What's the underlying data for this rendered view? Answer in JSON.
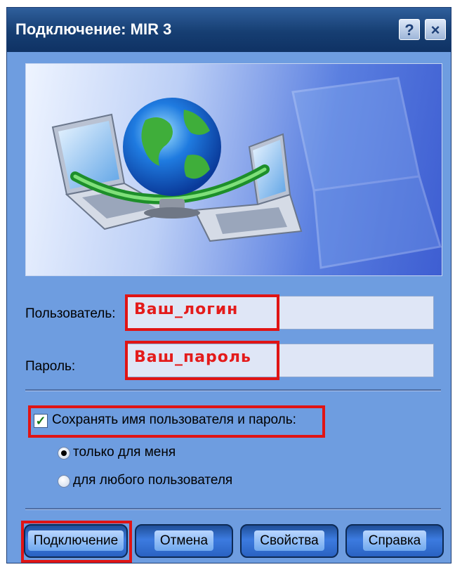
{
  "window": {
    "title": "Подключение: MIR 3",
    "help_label": "?",
    "close_label": "×"
  },
  "form": {
    "user_label": "Пользователь:",
    "user_value": "Ваш_логин",
    "password_label": "Пароль:",
    "password_value": "Ваш_пароль",
    "save_checkbox_label": "Сохранять имя пользователя и пароль:",
    "save_checked": true,
    "radio_only_me": "только для меня",
    "radio_any_user": "для любого пользователя",
    "selected_option": "только для меня"
  },
  "buttons": {
    "connect": "Подключение",
    "cancel": "Отмена",
    "properties": "Свойства",
    "help": "Справка"
  },
  "colors": {
    "highlight_red": "#e01414",
    "window_bg": "#6e9de0",
    "titlebar": "#163e72"
  },
  "icons": [
    "network-globe-icon",
    "laptop-icon",
    "help-icon",
    "close-icon",
    "checkmark-icon"
  ]
}
